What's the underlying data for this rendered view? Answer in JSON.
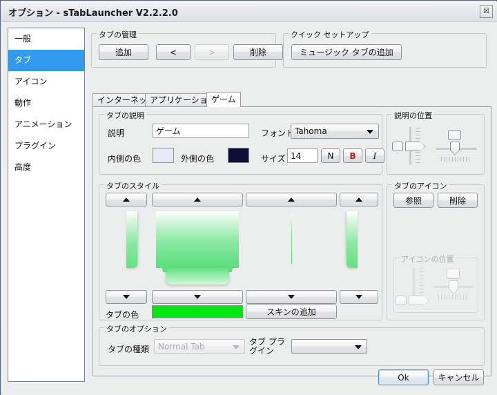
{
  "window": {
    "title": "オプション - sTabLauncher V2.2.2.0",
    "close_glyph": "☒"
  },
  "sidebar": {
    "items": [
      {
        "label": "一般",
        "selected": false
      },
      {
        "label": "タブ",
        "selected": true
      },
      {
        "label": "アイコン",
        "selected": false
      },
      {
        "label": "動作",
        "selected": false
      },
      {
        "label": "アニメーション",
        "selected": false
      },
      {
        "label": "プラグイン",
        "selected": false
      },
      {
        "label": "高度",
        "selected": false
      }
    ]
  },
  "tab_manage": {
    "legend": "タブの管理",
    "add": "追加",
    "prev": "<",
    "next": ">",
    "delete": "削除"
  },
  "quick_setup": {
    "legend": "クイック セットアップ",
    "add_music_tab": "ミュージック タブの追加"
  },
  "tabstrip": {
    "tabs": [
      {
        "label": "インターネット",
        "active": false
      },
      {
        "label": "アプリケーション",
        "active": false
      },
      {
        "label": "ゲーム",
        "active": true
      }
    ]
  },
  "tab_description": {
    "legend": "タブの説明",
    "desc_label": "説明",
    "desc_value": "ゲーム",
    "font_label": "フォント",
    "font_value": "Tahoma",
    "inner_color_label": "内側の色",
    "inner_color": "#eaeaf7",
    "outer_color_label": "外側の色",
    "outer_color": "#0d0d35",
    "size_label": "サイズ",
    "size_value": "14",
    "normal_btn": "N",
    "bold_btn": "B",
    "italic_btn": "I"
  },
  "desc_position": {
    "legend": "説明の位置"
  },
  "tab_style": {
    "legend": "タブのスタイル",
    "up_arrow": "▲",
    "down_arrow": "▼",
    "tab_color_label": "タブの色",
    "tab_color": "#00e810",
    "add_skin": "スキンの追加",
    "preview_gradient_top": "#ffffff",
    "preview_gradient_bottom": "#4ade68"
  },
  "tab_icon": {
    "legend": "タブのアイコン",
    "browse": "参照",
    "delete": "削除",
    "icon_position_legend": "アイコンの位置"
  },
  "tab_options": {
    "legend": "タブのオプション",
    "type_label": "タブの種類",
    "type_value": "Normal Tab",
    "plugin_label": "タブ プラグイン",
    "plugin_value": ""
  },
  "footer": {
    "ok": "Ok",
    "cancel": "キャンセル"
  }
}
